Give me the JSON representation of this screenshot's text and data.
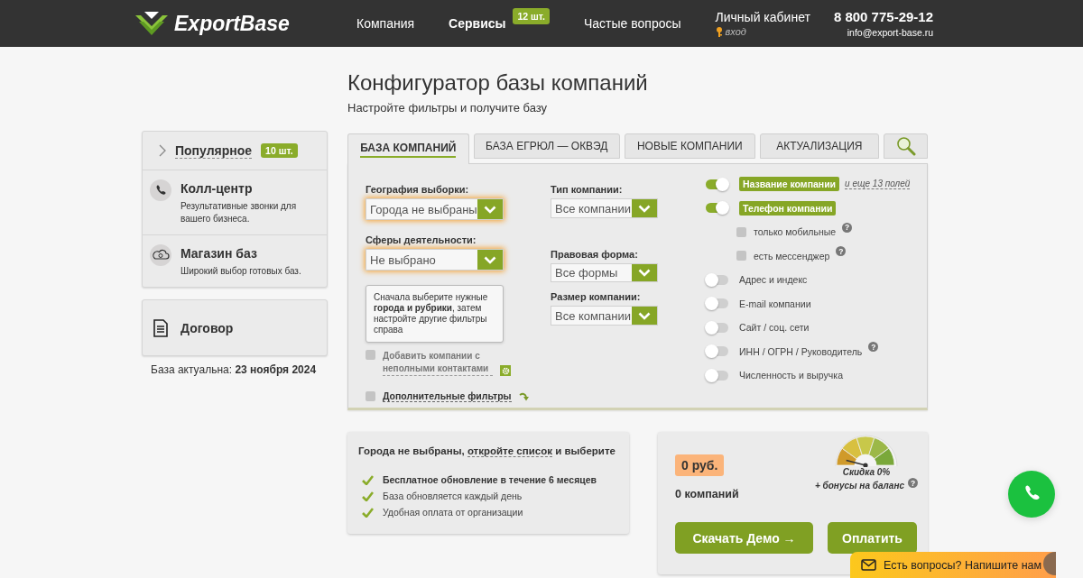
{
  "header": {
    "logo": "ExportBase",
    "nav": [
      {
        "label": "Компания",
        "selected": false
      },
      {
        "label": "Сервисы",
        "selected": true,
        "badge": "12 шт."
      },
      {
        "label": "Частые вопросы",
        "selected": false
      }
    ],
    "account": {
      "label": "Личный кабинет",
      "login": "вход"
    },
    "phone": "8 800 775-29-12",
    "email": "info@export-base.ru"
  },
  "page": {
    "title": "Конфигуратор базы компаний",
    "subtitle": "Настройте фильтры и получите базу"
  },
  "sidebar": {
    "popular": {
      "label": "Популярное",
      "badge": "10 шт."
    },
    "services": [
      {
        "kind": "call",
        "title": "Колл-центр",
        "description": "Результативные звонки для вашего бизнеса."
      },
      {
        "kind": "store",
        "title": "Магазин баз",
        "description": "Широкий выбор готовых баз."
      }
    ],
    "contract": "Договор",
    "updated": "База актуальна: **23 ноября 2024**"
  },
  "tabs": [
    {
      "label": "БАЗА КОМПАНИЙ",
      "selected": true
    },
    {
      "label": "БАЗА ЕГРЮЛ — ОКВЭД",
      "selected": false
    },
    {
      "label": "НОВЫЕ КОМПАНИИ",
      "selected": false
    },
    {
      "label": "АКТУАЛИЗАЦИЯ",
      "selected": false
    }
  ],
  "filters": {
    "geography": {
      "label": "География выборки:",
      "value": "Города не выбраны",
      "highlighted": true
    },
    "activity": {
      "label": "Сферы деятельности:",
      "value": "Не выбрано",
      "highlighted": true
    },
    "tooltip": "Сначала выберите нужные **города и рубрики**, затем настройте другие фильтры справа",
    "incomplete": {
      "label": "Добавить компании с неполными контактами",
      "checked": false
    },
    "extra": {
      "label": "Дополнительные фильтры",
      "checked": false
    },
    "company_type": {
      "label": "Тип компании:",
      "value": "Все компании"
    },
    "legal_form": {
      "label": "Правовая форма:",
      "value": "Все формы"
    },
    "size": {
      "label": "Размер компании:",
      "value": "Все компании"
    }
  },
  "fields": [
    {
      "kind": "toggle",
      "label": "Название компании",
      "on": true,
      "more": "и еще 13 полей"
    },
    {
      "kind": "toggle",
      "label": "Телефон компании",
      "on": true
    },
    {
      "kind": "checkbox",
      "label": "только мобильные",
      "checked": false,
      "help": "?"
    },
    {
      "kind": "checkbox",
      "label": "есть мессенджер",
      "checked": false,
      "help": "?"
    },
    {
      "kind": "toggle",
      "label": "Адрес и индекс",
      "on": false
    },
    {
      "kind": "toggle",
      "label": "E-mail компании",
      "on": false
    },
    {
      "kind": "toggle",
      "label": "Сайт / соц. сети",
      "on": false
    },
    {
      "kind": "toggle",
      "label": "ИНН / ОГРН / Руководитель",
      "on": false,
      "help": "?"
    },
    {
      "kind": "toggle",
      "label": "Численность и выручка",
      "on": false
    }
  ],
  "summary": {
    "text": "Города не выбраны, ",
    "link": "откройте список",
    "after": " и выберите",
    "benefits": [
      {
        "label": "Бесплатное обновление в течение 6 месяцев",
        "emphasis": true
      },
      {
        "label": "База обновляется каждый день",
        "emphasis": false
      },
      {
        "label": "Удобная оплата от организации",
        "emphasis": false
      }
    ]
  },
  "order": {
    "price": "0 руб.",
    "count": "0 компаний",
    "discount": "Скидка 0%",
    "bonus": "+ бонусы на баланс",
    "bonus_help": "?",
    "buttons": [
      {
        "label": "Скачать Демо →"
      },
      {
        "label": "Оплатить"
      }
    ]
  },
  "chat": "Есть вопросы? Напишите нам"
}
